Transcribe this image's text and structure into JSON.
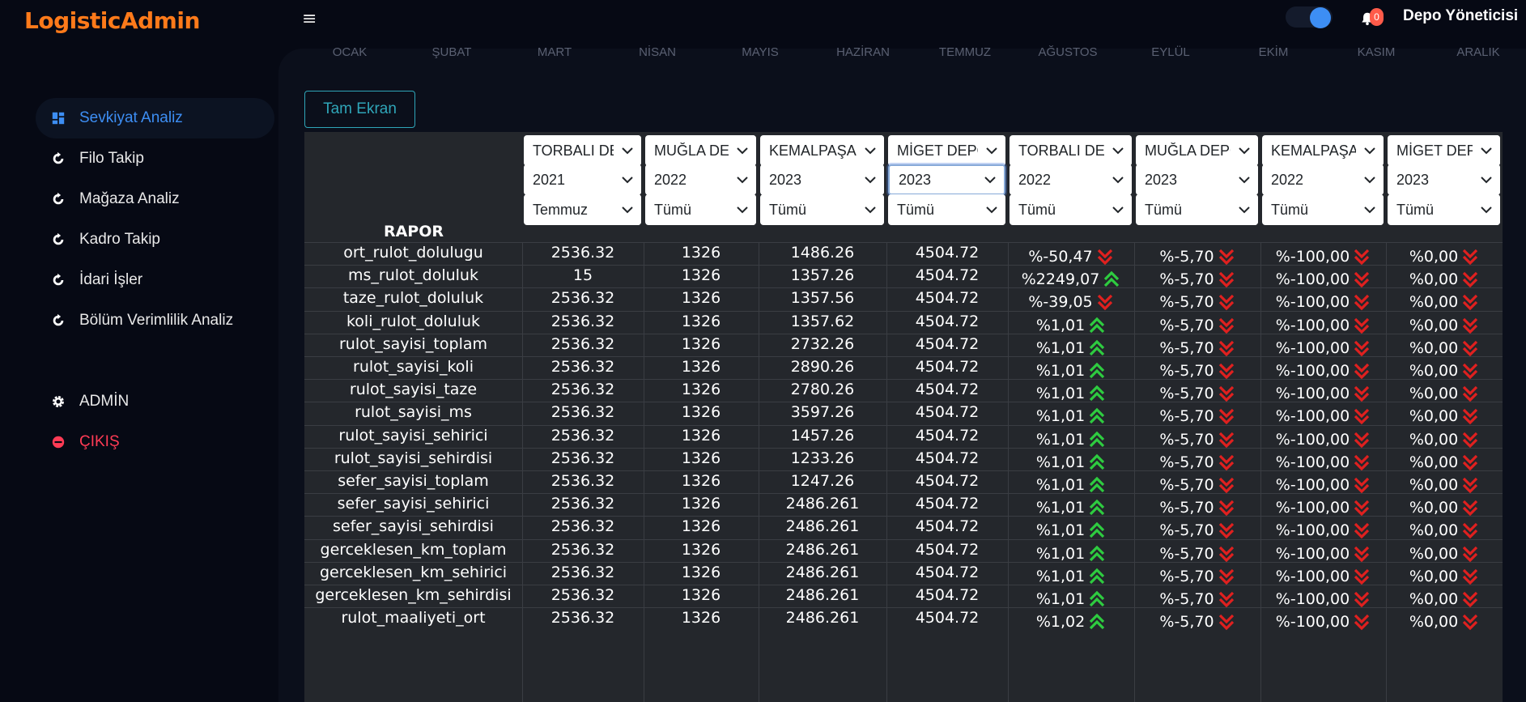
{
  "app": {
    "logo": "LogisticAdmin",
    "notification_count": "0",
    "user_name": "Depo Yöneticisi"
  },
  "sidebar": {
    "items": [
      {
        "label": "Sevkiyat Analiz",
        "icon": "grid-icon",
        "active": true
      },
      {
        "label": "Filo Takip",
        "icon": "refresh-icon"
      },
      {
        "label": "Mağaza Analiz",
        "icon": "refresh-icon"
      },
      {
        "label": "Kadro Takip",
        "icon": "refresh-icon"
      },
      {
        "label": "İdari İşler",
        "icon": "refresh-icon"
      },
      {
        "label": "Bölüm Verimlilik Analiz",
        "icon": "refresh-icon"
      }
    ],
    "admin": {
      "label": "ADMİN",
      "icon": "gear-icon"
    },
    "logout": {
      "label": "ÇIKIŞ",
      "icon": "minus-circle-icon"
    }
  },
  "months": [
    "OCAK",
    "ŞUBAT",
    "MART",
    "NİSAN",
    "MAYIS",
    "HAZİRAN",
    "TEMMUZ",
    "AĞUSTOS",
    "EYLÜL",
    "EKİM",
    "KASIM",
    "ARALIK"
  ],
  "toolbar": {
    "fullscreen_label": "Tam Ekran"
  },
  "table": {
    "rapor_header": "RAPOR",
    "filters": [
      {
        "depot": "TORBALI DEPO",
        "year": "2021",
        "month": "Temmuz"
      },
      {
        "depot": "MUĞLA DEPO",
        "year": "2022",
        "month": "Tümü"
      },
      {
        "depot": "KEMALPAŞA DEPO",
        "year": "2023",
        "month": "Tümü"
      },
      {
        "depot": "MİGET DEPO",
        "year": "2023",
        "month": "Tümü"
      },
      {
        "depot": "TORBALI DEPO",
        "year": "2022",
        "month": "Tümü"
      },
      {
        "depot": "MUĞLA DEPO",
        "year": "2023",
        "month": "Tümü"
      },
      {
        "depot": "KEMALPAŞA DEPO",
        "year": "2022",
        "month": "Tümü"
      },
      {
        "depot": "MİGET DEPO",
        "year": "2023",
        "month": "Tümü"
      }
    ],
    "rows": [
      {
        "name": "ort_rulot_dolulugu",
        "v": [
          "2536.32",
          "1326",
          "1486.26",
          "4504.72"
        ],
        "c": [
          {
            "t": "%-50,47",
            "d": "down"
          },
          {
            "t": "%-5,70",
            "d": "down"
          },
          {
            "t": "%-100,00",
            "d": "down"
          },
          {
            "t": "%0,00",
            "d": "down"
          }
        ]
      },
      {
        "name": "ms_rulot_doluluk",
        "v": [
          "15",
          "1326",
          "1357.26",
          "4504.72"
        ],
        "c": [
          {
            "t": "%2249,07",
            "d": "up"
          },
          {
            "t": "%-5,70",
            "d": "down"
          },
          {
            "t": "%-100,00",
            "d": "down"
          },
          {
            "t": "%0,00",
            "d": "down"
          }
        ]
      },
      {
        "name": "taze_rulot_doluluk",
        "v": [
          "2536.32",
          "1326",
          "1357.56",
          "4504.72"
        ],
        "c": [
          {
            "t": "%-39,05",
            "d": "down"
          },
          {
            "t": "%-5,70",
            "d": "down"
          },
          {
            "t": "%-100,00",
            "d": "down"
          },
          {
            "t": "%0,00",
            "d": "down"
          }
        ]
      },
      {
        "name": "koli_rulot_doluluk",
        "v": [
          "2536.32",
          "1326",
          "1357.62",
          "4504.72"
        ],
        "c": [
          {
            "t": "%1,01",
            "d": "up"
          },
          {
            "t": "%-5,70",
            "d": "down"
          },
          {
            "t": "%-100,00",
            "d": "down"
          },
          {
            "t": "%0,00",
            "d": "down"
          }
        ]
      },
      {
        "name": "rulot_sayisi_toplam",
        "v": [
          "2536.32",
          "1326",
          "2732.26",
          "4504.72"
        ],
        "c": [
          {
            "t": "%1,01",
            "d": "up"
          },
          {
            "t": "%-5,70",
            "d": "down"
          },
          {
            "t": "%-100,00",
            "d": "down"
          },
          {
            "t": "%0,00",
            "d": "down"
          }
        ]
      },
      {
        "name": "rulot_sayisi_koli",
        "v": [
          "2536.32",
          "1326",
          "2890.26",
          "4504.72"
        ],
        "c": [
          {
            "t": "%1,01",
            "d": "up"
          },
          {
            "t": "%-5,70",
            "d": "down"
          },
          {
            "t": "%-100,00",
            "d": "down"
          },
          {
            "t": "%0,00",
            "d": "down"
          }
        ]
      },
      {
        "name": "rulot_sayisi_taze",
        "v": [
          "2536.32",
          "1326",
          "2780.26",
          "4504.72"
        ],
        "c": [
          {
            "t": "%1,01",
            "d": "up"
          },
          {
            "t": "%-5,70",
            "d": "down"
          },
          {
            "t": "%-100,00",
            "d": "down"
          },
          {
            "t": "%0,00",
            "d": "down"
          }
        ]
      },
      {
        "name": "rulot_sayisi_ms",
        "v": [
          "2536.32",
          "1326",
          "3597.26",
          "4504.72"
        ],
        "c": [
          {
            "t": "%1,01",
            "d": "up"
          },
          {
            "t": "%-5,70",
            "d": "down"
          },
          {
            "t": "%-100,00",
            "d": "down"
          },
          {
            "t": "%0,00",
            "d": "down"
          }
        ]
      },
      {
        "name": "rulot_sayisi_sehirici",
        "v": [
          "2536.32",
          "1326",
          "1457.26",
          "4504.72"
        ],
        "c": [
          {
            "t": "%1,01",
            "d": "up"
          },
          {
            "t": "%-5,70",
            "d": "down"
          },
          {
            "t": "%-100,00",
            "d": "down"
          },
          {
            "t": "%0,00",
            "d": "down"
          }
        ]
      },
      {
        "name": "rulot_sayisi_sehirdisi",
        "v": [
          "2536.32",
          "1326",
          "1233.26",
          "4504.72"
        ],
        "c": [
          {
            "t": "%1,01",
            "d": "up"
          },
          {
            "t": "%-5,70",
            "d": "down"
          },
          {
            "t": "%-100,00",
            "d": "down"
          },
          {
            "t": "%0,00",
            "d": "down"
          }
        ]
      },
      {
        "name": "sefer_sayisi_toplam",
        "v": [
          "2536.32",
          "1326",
          "1247.26",
          "4504.72"
        ],
        "c": [
          {
            "t": "%1,01",
            "d": "up"
          },
          {
            "t": "%-5,70",
            "d": "down"
          },
          {
            "t": "%-100,00",
            "d": "down"
          },
          {
            "t": "%0,00",
            "d": "down"
          }
        ]
      },
      {
        "name": "sefer_sayisi_sehirici",
        "v": [
          "2536.32",
          "1326",
          "2486.261",
          "4504.72"
        ],
        "c": [
          {
            "t": "%1,01",
            "d": "up"
          },
          {
            "t": "%-5,70",
            "d": "down"
          },
          {
            "t": "%-100,00",
            "d": "down"
          },
          {
            "t": "%0,00",
            "d": "down"
          }
        ]
      },
      {
        "name": "sefer_sayisi_sehirdisi",
        "v": [
          "2536.32",
          "1326",
          "2486.261",
          "4504.72"
        ],
        "c": [
          {
            "t": "%1,01",
            "d": "up"
          },
          {
            "t": "%-5,70",
            "d": "down"
          },
          {
            "t": "%-100,00",
            "d": "down"
          },
          {
            "t": "%0,00",
            "d": "down"
          }
        ]
      },
      {
        "name": "gerceklesen_km_toplam",
        "v": [
          "2536.32",
          "1326",
          "2486.261",
          "4504.72"
        ],
        "c": [
          {
            "t": "%1,01",
            "d": "up"
          },
          {
            "t": "%-5,70",
            "d": "down"
          },
          {
            "t": "%-100,00",
            "d": "down"
          },
          {
            "t": "%0,00",
            "d": "down"
          }
        ]
      },
      {
        "name": "gerceklesen_km_sehirici",
        "v": [
          "2536.32",
          "1326",
          "2486.261",
          "4504.72"
        ],
        "c": [
          {
            "t": "%1,01",
            "d": "up"
          },
          {
            "t": "%-5,70",
            "d": "down"
          },
          {
            "t": "%-100,00",
            "d": "down"
          },
          {
            "t": "%0,00",
            "d": "down"
          }
        ]
      },
      {
        "name": "gerceklesen_km_sehirdisi",
        "v": [
          "2536.32",
          "1326",
          "2486.261",
          "4504.72"
        ],
        "c": [
          {
            "t": "%1,01",
            "d": "up"
          },
          {
            "t": "%-5,70",
            "d": "down"
          },
          {
            "t": "%-100,00",
            "d": "down"
          },
          {
            "t": "%0,00",
            "d": "down"
          }
        ]
      },
      {
        "name": "rulot_maaliyeti_ort",
        "v": [
          "2536.32",
          "1326",
          "2486.261",
          "4504.72"
        ],
        "c": [
          {
            "t": "%1,02",
            "d": "up"
          },
          {
            "t": "%-5,70",
            "d": "down"
          },
          {
            "t": "%-100,00",
            "d": "down"
          },
          {
            "t": "%0,00",
            "d": "down"
          }
        ]
      }
    ]
  },
  "colors": {
    "accent": "#3d8ef4",
    "logo": "#ff7a1a",
    "up": "#2ecc40",
    "down": "#e0201f",
    "danger": "#ff3b55"
  }
}
